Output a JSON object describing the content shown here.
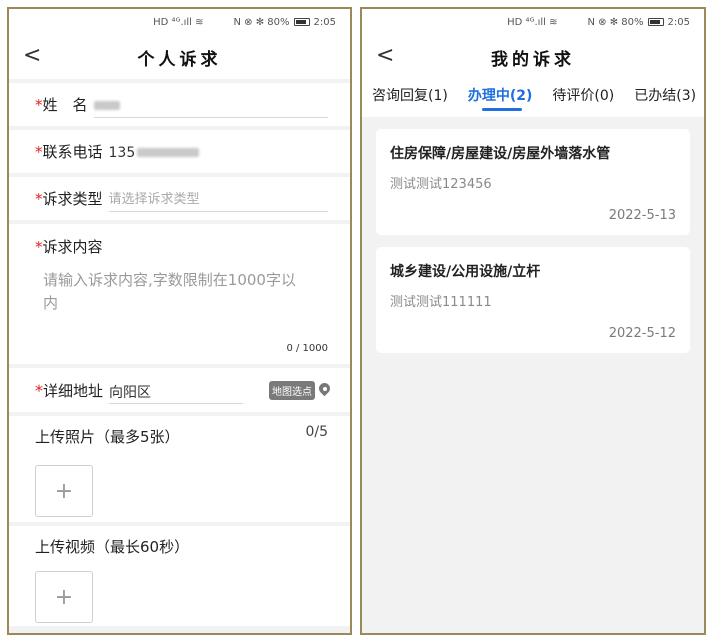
{
  "left": {
    "status": {
      "signal": "HD ⁴ᴳ.ıll ≋",
      "right_icons": "N ⊗ ✻ 80%",
      "time": "2:05"
    },
    "nav": {
      "back": "<",
      "title": "个人诉求"
    },
    "form": {
      "name": {
        "required": "*",
        "label": "姓　名"
      },
      "phone": {
        "required": "*",
        "label": "联系电话",
        "value_prefix": "135"
      },
      "type": {
        "required": "*",
        "label": "诉求类型",
        "placeholder": "请选择诉求类型"
      },
      "content": {
        "required": "*",
        "label": "诉求内容",
        "placeholder": "请输入诉求内容,字数限制在1000字以内",
        "counter": "0 / 1000"
      },
      "address": {
        "required": "*",
        "label": "详细地址",
        "value": "向阳区",
        "map_button": "地图选点"
      },
      "photo": {
        "label": "上传照片（最多5张）",
        "count": "0/5",
        "add": "+"
      },
      "video": {
        "label": "上传视频（最长60秒）",
        "add": "+"
      }
    }
  },
  "right": {
    "status": {
      "signal": "HD ⁴ᴳ.ıll ≋",
      "right_icons": "N ⊗ ✻ 80%",
      "time": "2:05"
    },
    "nav": {
      "back": "<",
      "title": "我的诉求"
    },
    "tabs": [
      {
        "label": "咨询回复(1)"
      },
      {
        "label": "办理中(2)"
      },
      {
        "label": "待评价(0)"
      },
      {
        "label": "已办结(3)"
      }
    ],
    "cards": [
      {
        "title": "住房保障/房屋建设/房屋外墙落水管",
        "desc": "测试测试123456",
        "date": "2022-5-13"
      },
      {
        "title": "城乡建设/公用设施/立杆",
        "desc": "测试测试111111",
        "date": "2022-5-12"
      }
    ]
  }
}
